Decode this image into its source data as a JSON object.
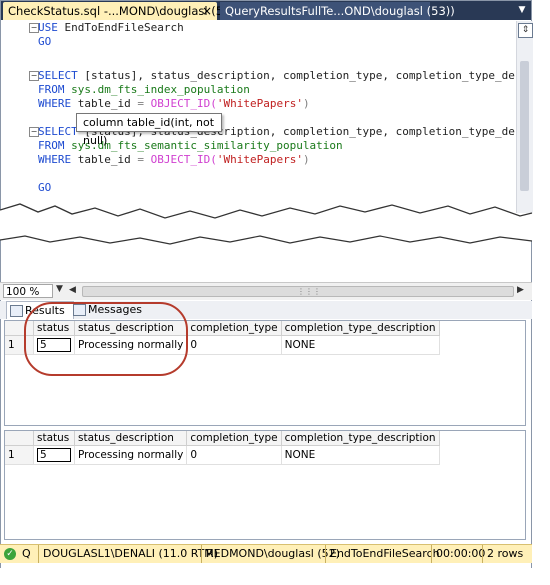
{
  "tabs": {
    "active": "CheckStatus.sql -...MOND\\douglasl (52))",
    "active_close": "×",
    "inactive": "QueryResultsFullTe...OND\\douglasl (53))"
  },
  "code": {
    "l1_kw": "USE",
    "l1_rest": " EndToEndFileSearch",
    "l2": "GO",
    "l4_kw": "SELECT",
    "l4_rest": " [status], status_description, completion_type, completion_type_descript",
    "l5_kw": "FROM",
    "l5_sys": " sys.dm_fts_index_population",
    "l6_kw": "WHERE",
    "l6_mid": " table_id ",
    "l6_eq": "=",
    "l6_fn": " OBJECT_ID(",
    "l6_str": "'WhitePapers'",
    "l6_end": ")",
    "l8_kw": "SELECT",
    "l8_rest": " [status], status_description, completion_type, completion_type_descript",
    "l9_kw": "FROM",
    "l9_sys": " sys.dm_fts_semantic_similarity_population",
    "l10_kw": "WHERE",
    "l10_mid": " table_id ",
    "l10_eq": "=",
    "l10_fn": " OBJECT_ID(",
    "l10_str": "'WhitePapers'",
    "l10_end": ")",
    "l12": "GO"
  },
  "tooltip": "column table_id(int, not null)",
  "zoom": "100 %",
  "results_tabs": {
    "results": "Results",
    "messages": "Messages"
  },
  "grid_headers": [
    "status",
    "status_description",
    "completion_type",
    "completion_type_description"
  ],
  "grid1_rows": [
    {
      "row": "1",
      "status": "5",
      "status_description": "Processing normally",
      "completion_type": "0",
      "completion_type_description": "NONE"
    }
  ],
  "grid2_rows": [
    {
      "row": "1",
      "status": "5",
      "status_description": "Processing normally",
      "completion_type": "0",
      "completion_type_description": "NONE"
    }
  ],
  "status_bar": {
    "query_state": "Q",
    "server": "DOUGLASL1\\DENALI (11.0 RTM)",
    "user": "REDMOND\\douglasl (52)",
    "database": "EndToEndFileSearch",
    "elapsed": "00:00:00",
    "rows": "2 rows"
  },
  "colors": {
    "tab_strip": "#293955",
    "active_tab": "#fff0b8",
    "status_bar": "#fff0b8",
    "keyword": "#1e4bd0",
    "system_object": "#1a7a1a",
    "string": "#c02020",
    "highlight_ellipse": "#b53b2c"
  },
  "icons": {
    "tab_menu": "dropdown-arrow-icon",
    "split": "split-window-icon",
    "results_tab": "grid-icon",
    "messages_tab": "message-icon",
    "status": "green-check-icon"
  }
}
